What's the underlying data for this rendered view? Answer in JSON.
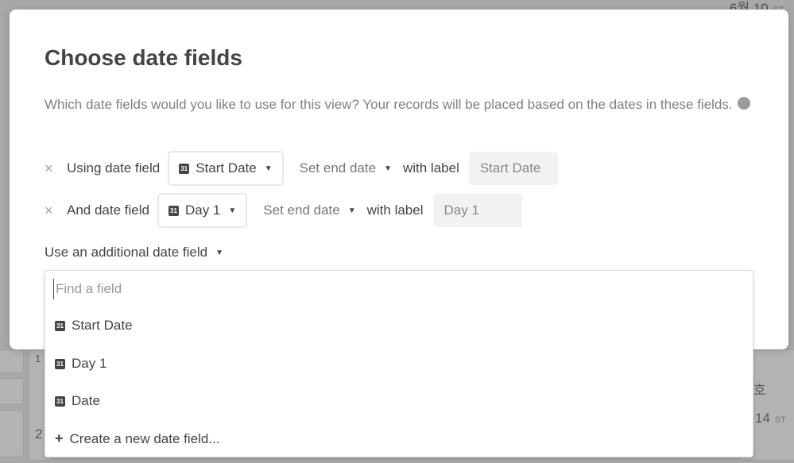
{
  "background": {
    "fragments": [
      "6월 10",
      "ST",
      "14",
      "ST",
      "호",
      "2",
      "1"
    ]
  },
  "modal": {
    "title": "Choose date fields",
    "description": "Which date fields would you like to use for this view? Your records will be placed based on the dates in these fields.",
    "help_icon": "?",
    "rows": [
      {
        "prefix": "Using date field",
        "field": "Start Date",
        "end_date_label": "Set end date",
        "with_label": "with label",
        "label_value": "Start Date"
      },
      {
        "prefix": "And date field",
        "field": "Day 1",
        "end_date_label": "Set end date",
        "with_label": "with label",
        "label_value": "Day 1"
      }
    ],
    "additional": "Use an additional date field",
    "dropdown": {
      "placeholder": "Find a field",
      "options": [
        "Start Date",
        "Day 1",
        "Date"
      ],
      "create": "Create a new date field..."
    }
  },
  "icons": {
    "remove": "×",
    "calendar": "31",
    "caret": "▼",
    "plus": "+"
  }
}
